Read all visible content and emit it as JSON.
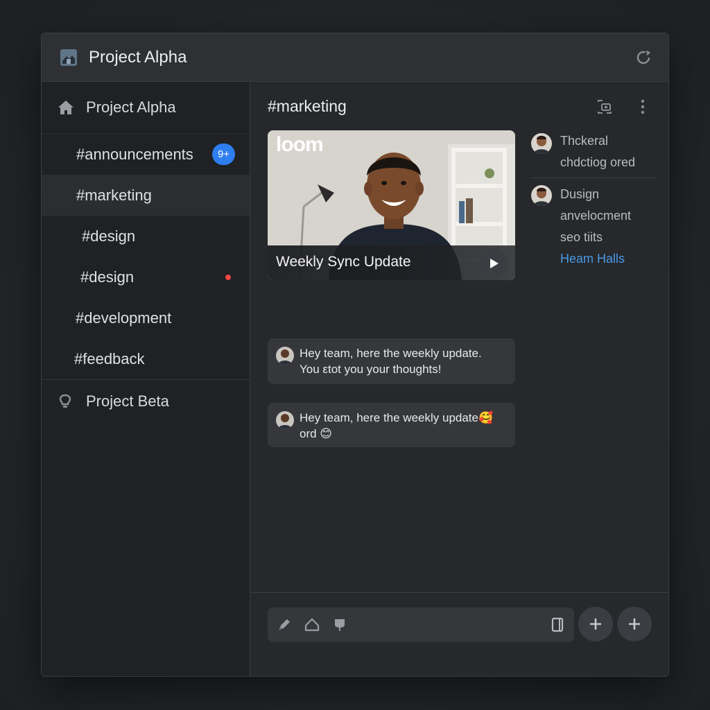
{
  "window": {
    "title": "Project Alpha"
  },
  "sidebar": {
    "workspace": "Project Alpha",
    "channels": [
      {
        "label": "#announcements",
        "badge": "9+"
      },
      {
        "label": "#marketing",
        "selected": true
      },
      {
        "label": "#design"
      },
      {
        "label": "#design",
        "unread_dot": true
      },
      {
        "label": "#development"
      },
      {
        "label": "#feedback"
      }
    ],
    "other_workspace": "Project Beta"
  },
  "channel": {
    "title": "#marketing"
  },
  "video": {
    "brand": "loom",
    "title": "Weekly Sync Update"
  },
  "messages": [
    {
      "line1": "Hey team, here the weekly update.",
      "line2": "You εtot you your thoughts!"
    },
    {
      "line1": "Hey team, here the weekly update🥰",
      "line2": "ord 😊"
    }
  ],
  "thread": [
    {
      "lines": [
        "Thckeral",
        "chdctiog ored"
      ]
    },
    {
      "lines": [
        "Dusign",
        "anvelocment",
        "seo tiits",
        "Heam Halls"
      ]
    }
  ],
  "colors": {
    "accent": "#2f7ef0",
    "unread": "#f04444",
    "link": "#4a9ae8"
  }
}
